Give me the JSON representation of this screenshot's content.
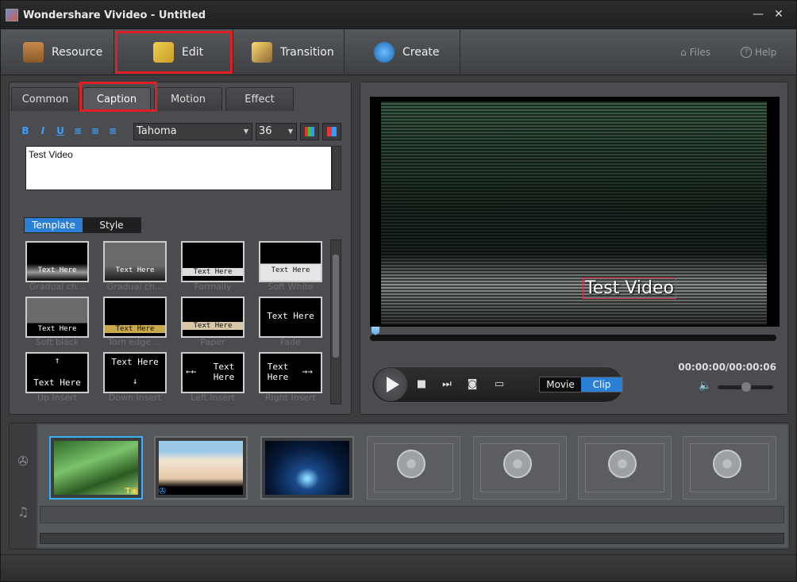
{
  "window": {
    "title": "Wondershare Vivideo - Untitled",
    "minimize": "—",
    "close": "✕"
  },
  "toolbar": {
    "resource": "Resource",
    "edit": "Edit",
    "transition": "Transition",
    "create": "Create",
    "files": "Files",
    "help": "Help"
  },
  "edit_panel": {
    "tabs": [
      "Common",
      "Caption",
      "Motion",
      "Effect"
    ],
    "format": {
      "bold": "B",
      "italic": "I",
      "underline": "U",
      "font": "Tahoma",
      "size": "36"
    },
    "caption_text": "Test Video",
    "mode": {
      "template": "Template",
      "style": "Style"
    },
    "templates": [
      {
        "label": "Gradual ch...",
        "preview": "Text Here"
      },
      {
        "label": "Gradual ch...",
        "preview": "Text Here"
      },
      {
        "label": "Formally",
        "preview": "Text Here"
      },
      {
        "label": "Soft White",
        "preview": "Text Here"
      },
      {
        "label": "Soft black",
        "preview": "Text Here"
      },
      {
        "label": "Torn edge ...",
        "preview": "Text Here"
      },
      {
        "label": "Paper",
        "preview": "Text Here"
      },
      {
        "label": "Fade",
        "preview": "Text Here"
      },
      {
        "label": "Up Insert",
        "preview": "Text Here"
      },
      {
        "label": "Down Insert",
        "preview": "Text Here"
      },
      {
        "label": "Left Insert",
        "preview": "Text Here"
      },
      {
        "label": "Right Insert",
        "preview": "Text Here"
      }
    ]
  },
  "preview": {
    "caption_overlay": "Test Video",
    "timecode": "00:00:00/00:00:06",
    "view_mode": {
      "movie": "Movie",
      "clip": "Clip"
    },
    "progress": 0.0
  },
  "accent_colors": {
    "selection": "#2b80d6",
    "highlight": "#e01f24"
  }
}
